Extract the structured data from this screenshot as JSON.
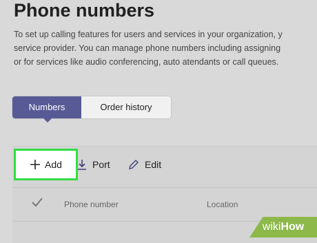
{
  "page": {
    "title": "Phone numbers",
    "description_lines": [
      "To set up calling features for users and services in your organization, y",
      "service provider. You can manage phone numbers including assigning",
      "or for services like audio conferencing, auto atendants or call queues."
    ]
  },
  "tabs": [
    {
      "label": "Numbers",
      "selected": true
    },
    {
      "label": "Order history",
      "selected": false
    }
  ],
  "toolbar": {
    "add_label": "Add",
    "port_label": "Port",
    "edit_label": "Edit",
    "add_icon": "plus-icon",
    "port_icon": "download-arrow-icon",
    "edit_icon": "pencil-icon"
  },
  "table": {
    "headers": [
      "Phone number",
      "Location"
    ]
  },
  "watermark": {
    "prefix": "wiki",
    "suffix": "How"
  },
  "colors": {
    "selected_tab": "#585a95",
    "highlight": "#33dd44",
    "watermark": "#8db84a"
  }
}
